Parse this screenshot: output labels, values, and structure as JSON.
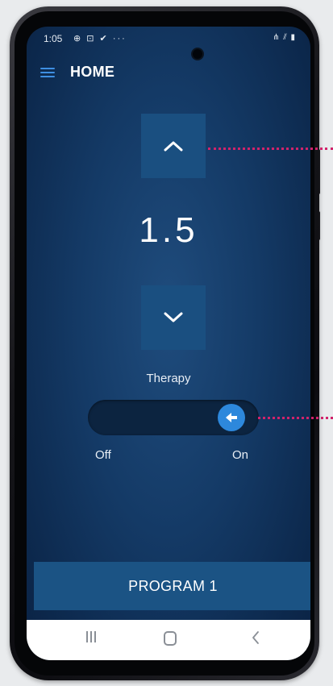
{
  "status_bar": {
    "time": "1:05",
    "notification_icons": "⊕ ⊡ ✔ ···",
    "system_icons": "⋔ ⫽ ▮"
  },
  "app_bar": {
    "title": "HOME"
  },
  "therapy_control": {
    "value": "1.5",
    "label": "Therapy",
    "toggle_off_label": "Off",
    "toggle_on_label": "On",
    "toggle_state": "on"
  },
  "program_button": {
    "label": "PROGRAM 1"
  },
  "colors": {
    "accent_blue": "#2d88dc",
    "button_blue": "#1a4f80",
    "screen_background": "#143a66",
    "callout_magenta": "#d1236b"
  },
  "icons": {
    "menu": "hamburger-menu-icon",
    "increase": "chevron-up-icon",
    "decrease": "chevron-down-icon",
    "toggle_knob": "arrow-left-icon",
    "nav_recents": "recent-apps-icon",
    "nav_home": "home-icon",
    "nav_back": "back-icon"
  }
}
